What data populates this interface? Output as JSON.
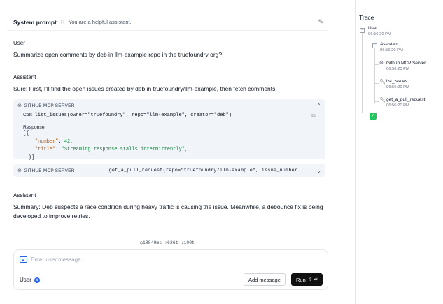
{
  "system": {
    "label": "System prompt",
    "value": "You are a helpful assistant."
  },
  "messages": {
    "user_role": "User",
    "user_text": "Summarize open comments by deb in llm-example repo in the truefoundry org?",
    "assistant_role_1": "Assistant",
    "assistant_text_1": "Sure! First, I'll find the open issues created by deb in truefoundry/llm-example, then fetch comments.",
    "assistant_role_2": "Assistant",
    "assistant_text_2": "Summary: Deb suspects a race condition during heavy traffic is causing the issue. Meanwhile, a debounce fix is being developed to improve retries."
  },
  "tool_call_1": {
    "server": "GITHUB MCP SERVER",
    "call_label": "Call:",
    "call": "list_issues(owner=\"truefoundry\", repo=\"llm-example\", creator=\"deb\")",
    "response_label": "Response:",
    "line_open": "[{",
    "number_key": "\"number\"",
    "number_val": "42,",
    "title_key": "\"title\"",
    "title_val": "\"Streaming response stalls intermittently\",",
    "line_close": "}]"
  },
  "tool_call_2": {
    "server": "GITHUB MCP SERVER",
    "call": "get_a_pull_request(repo=\"truefoundry/llm-example\", issue_number..."
  },
  "stats": {
    "time": "18849ms",
    "input_tokens": "636t",
    "output_tokens": "100t"
  },
  "composer": {
    "placeholder": "Enter user message...",
    "role": "User",
    "add_button": "Add message",
    "run_button": "Run"
  },
  "trace": {
    "title": "Trace",
    "nodes": [
      {
        "label": "User",
        "time": "06:56:20 PM"
      },
      {
        "label": "Assistant",
        "time": "06:56:20 PM"
      },
      {
        "label": "Github MCP Server",
        "time": "06:56:20 PM"
      },
      {
        "label": "list_issues",
        "time": "06:56:20 PM"
      },
      {
        "label": "get_a_pull_request",
        "time": "06:56:20 PM"
      }
    ]
  }
}
